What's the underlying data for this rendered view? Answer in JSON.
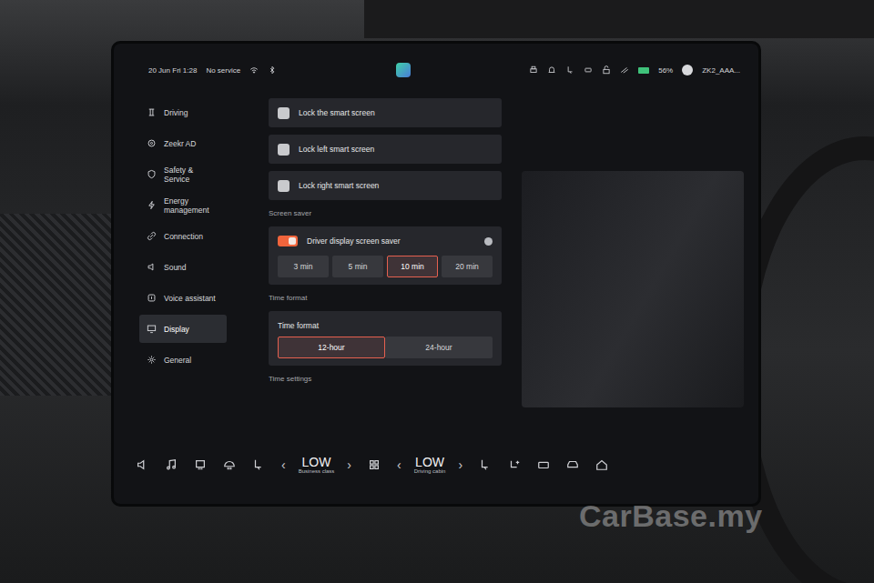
{
  "status_bar": {
    "datetime": "20 Jun Fri 1:28",
    "signal": "No service",
    "battery": "56%",
    "profile": "ZK2_AAA..."
  },
  "sidebar": {
    "items": [
      {
        "label": "Driving",
        "selected": false
      },
      {
        "label": "Zeekr AD",
        "selected": false
      },
      {
        "label": "Safety & Service",
        "selected": false
      },
      {
        "label": "Energy management",
        "selected": false
      },
      {
        "label": "Connection",
        "selected": false
      },
      {
        "label": "Sound",
        "selected": false
      },
      {
        "label": "Voice assistant",
        "selected": false
      },
      {
        "label": "Display",
        "selected": true
      },
      {
        "label": "General",
        "selected": false
      }
    ]
  },
  "locks": [
    {
      "label": "Lock the smart screen",
      "checked": false
    },
    {
      "label": "Lock left smart screen",
      "checked": false
    },
    {
      "label": "Lock right smart screen",
      "checked": false
    }
  ],
  "screen_saver": {
    "heading": "Screen saver",
    "label": "Driver display screen saver",
    "on": true,
    "options": [
      {
        "label": "3 min",
        "selected": false
      },
      {
        "label": "5 min",
        "selected": false
      },
      {
        "label": "10 min",
        "selected": true
      },
      {
        "label": "20 min",
        "selected": false
      }
    ]
  },
  "time_format": {
    "heading": "Time format",
    "label": "Time format",
    "options": [
      {
        "label": "12-hour",
        "selected": true
      },
      {
        "label": "24-hour",
        "selected": false
      }
    ]
  },
  "time_settings": {
    "heading": "Time settings"
  },
  "bottom_bar": {
    "controls": [
      {
        "prev": "‹",
        "value": "LOW",
        "label": "Business class",
        "next": "›"
      },
      {
        "prev": "‹",
        "value": "LOW",
        "label": "Driving cabin",
        "next": "›"
      }
    ]
  },
  "watermark": "CarBase.my"
}
